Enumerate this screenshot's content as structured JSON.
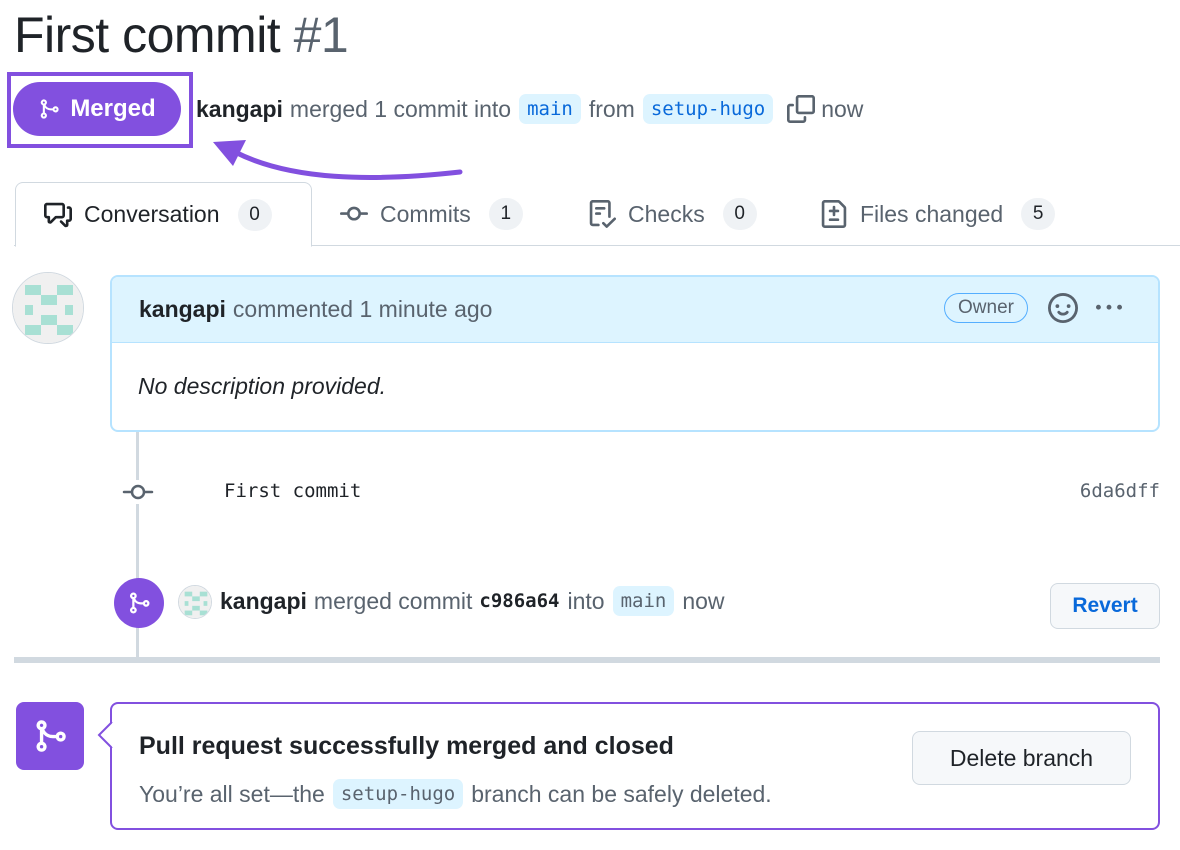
{
  "pr": {
    "title": "First commit",
    "number": "#1",
    "state": "Merged",
    "author": "kangapi",
    "merge_summary": "merged 1 commit into",
    "base_branch": "main",
    "from_label": "from",
    "head_branch": "setup-hugo",
    "time": "now"
  },
  "tabs": [
    {
      "label": "Conversation",
      "count": "0",
      "icon": "comment-discussion-icon"
    },
    {
      "label": "Commits",
      "count": "1",
      "icon": "git-commit-icon"
    },
    {
      "label": "Checks",
      "count": "0",
      "icon": "checklist-icon"
    },
    {
      "label": "Files changed",
      "count": "5",
      "icon": "file-diff-icon"
    }
  ],
  "comment": {
    "author": "kangapi",
    "action": "commented 1 minute ago",
    "role": "Owner",
    "body": "No description provided."
  },
  "commit": {
    "message": "First commit",
    "sha": "6da6dff"
  },
  "merge_event": {
    "author": "kangapi",
    "action": "merged commit",
    "sha": "c986a64",
    "into": "into",
    "branch": "main",
    "time": "now",
    "revert_label": "Revert"
  },
  "merged_box": {
    "title": "Pull request successfully merged and closed",
    "sub_before": "You’re all set—the",
    "branch": "setup-hugo",
    "sub_after": "branch can be safely deleted.",
    "delete_label": "Delete branch"
  },
  "colors": {
    "merged_purple": "#8250df",
    "link_blue": "#0969da",
    "branch_bg": "#ddf4ff",
    "comment_border": "#b6e3ff"
  }
}
